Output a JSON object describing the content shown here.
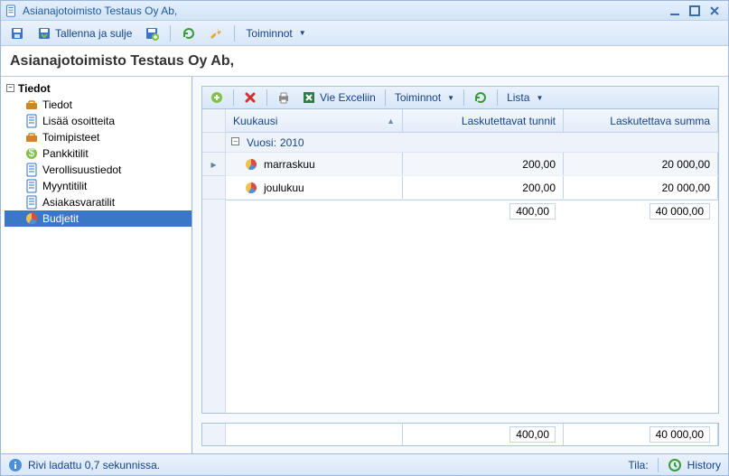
{
  "window": {
    "title": "Asianajotoimisto Testaus Oy Ab,"
  },
  "toolbar": {
    "save_close": "Tallenna ja sulje",
    "toiminnot": "Toiminnot"
  },
  "header": {
    "title": "Asianajotoimisto Testaus Oy Ab,"
  },
  "tree": {
    "root": "Tiedot",
    "items": [
      {
        "label": "Tiedot",
        "icon": "briefcase"
      },
      {
        "label": "Lisää osoitteita",
        "icon": "doc"
      },
      {
        "label": "Toimipisteet",
        "icon": "briefcase"
      },
      {
        "label": "Pankkitilit",
        "icon": "money"
      },
      {
        "label": "Verollisuustiedot",
        "icon": "doc"
      },
      {
        "label": "Myyntitilit",
        "icon": "doc"
      },
      {
        "label": "Asiakasvaratilit",
        "icon": "doc"
      },
      {
        "label": "Budjetit",
        "icon": "pie"
      }
    ],
    "selected": 7
  },
  "grid_toolbar": {
    "vie_exceliin": "Vie Exceliin",
    "toiminnot": "Toiminnot",
    "lista": "Lista"
  },
  "grid": {
    "columns": {
      "month": "Kuukausi",
      "hours": "Laskutettavat tunnit",
      "sum": "Laskutettava summa"
    },
    "group": {
      "label": "Vuosi:",
      "value": "2010"
    },
    "rows": [
      {
        "month": "marraskuu",
        "hours": "200,00",
        "sum": "20 000,00"
      },
      {
        "month": "joulukuu",
        "hours": "200,00",
        "sum": "20 000,00"
      }
    ],
    "subtotal": {
      "hours": "400,00",
      "sum": "40 000,00"
    },
    "footer": {
      "hours": "400,00",
      "sum": "40 000,00"
    }
  },
  "status": {
    "text": "Rivi ladattu 0,7 sekunnissa.",
    "tila": "Tila:",
    "history": "History"
  }
}
